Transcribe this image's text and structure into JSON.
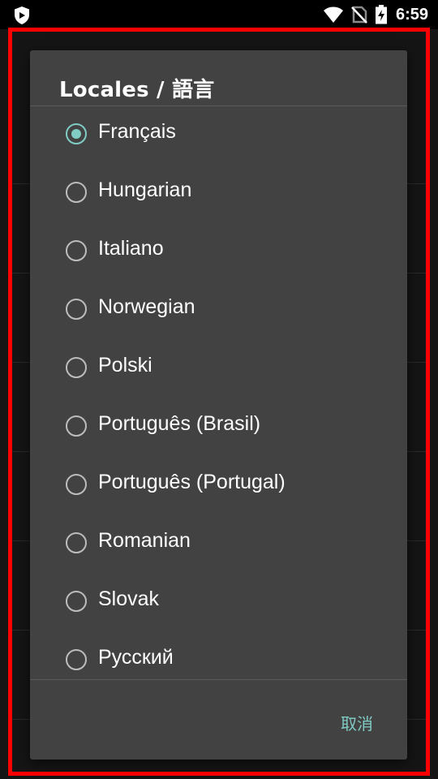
{
  "status_bar": {
    "time": "6:59",
    "icons": [
      "shield-icon",
      "wifi-icon",
      "no-sim-icon",
      "battery-charging-icon"
    ]
  },
  "dialog": {
    "title": "Locales / 語言",
    "options": [
      {
        "label": "Français",
        "checked": true
      },
      {
        "label": "Hungarian",
        "checked": false
      },
      {
        "label": "Italiano",
        "checked": false
      },
      {
        "label": "Norwegian",
        "checked": false
      },
      {
        "label": "Polski",
        "checked": false
      },
      {
        "label": "Português (Brasil)",
        "checked": false
      },
      {
        "label": "Português (Portugal)",
        "checked": false
      },
      {
        "label": "Romanian",
        "checked": false
      },
      {
        "label": "Slovak",
        "checked": false
      },
      {
        "label": "Русский",
        "checked": false
      }
    ],
    "cancel_label": "取消"
  },
  "colors": {
    "accent": "#80cbc4",
    "dialog_bg": "#424242",
    "frame": "#ff0000"
  }
}
